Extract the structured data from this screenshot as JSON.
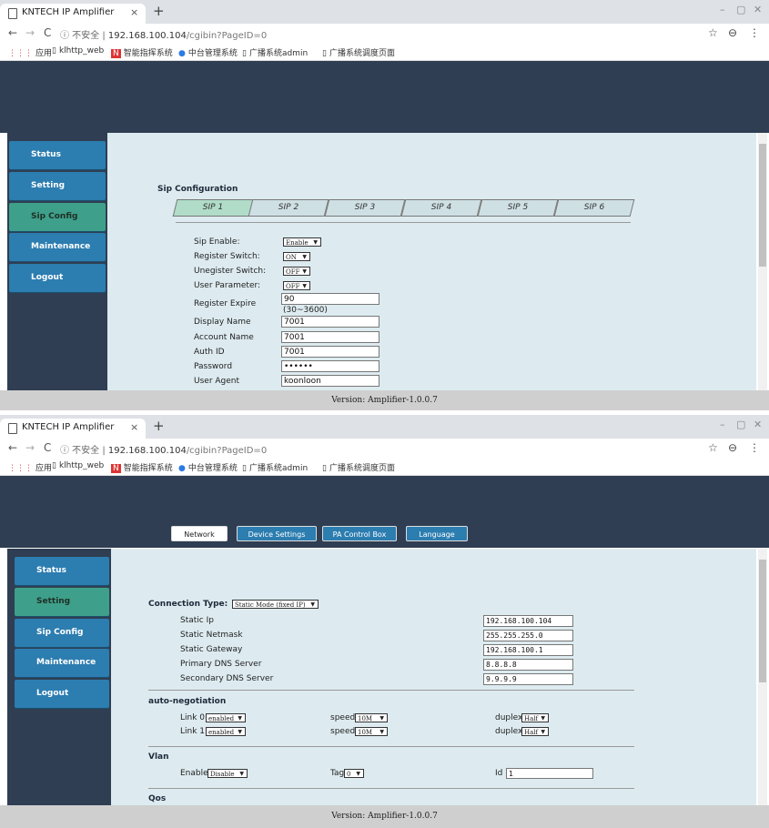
{
  "browser": {
    "tab_title": "KNTECH IP Amplifier",
    "tab_close": "×",
    "new_tab": "+",
    "back": "←",
    "forward": "→",
    "reload": "C",
    "url_info": "ⓘ 不安全 |",
    "url_host": "192.168.100.104",
    "url_path": "/cgibin?PageID=0",
    "star": "☆",
    "account": "⊖",
    "menu": "⋮",
    "win_min": "–",
    "win_max": "▢",
    "win_close": "✕",
    "bookmarks": [
      "应用",
      "klhttp_web",
      "智能指挥系统",
      "中台管理系统",
      "广播系统admin",
      "广播系统调度页面"
    ]
  },
  "nav": {
    "status": "Status",
    "setting": "Setting",
    "sip_config": "Sip Config",
    "maintenance": "Maintenance",
    "logout": "Logout"
  },
  "footer": {
    "version": "Version: Amplifier-1.0.0.7"
  },
  "sip_page": {
    "section_title": "Sip Configuration",
    "tabs": [
      "SIP 1",
      "SIP 2",
      "SIP 3",
      "SIP 4",
      "SIP 5",
      "SIP 6"
    ],
    "active_tab": "SIP 1",
    "sip_enable_label": "Sip Enable:",
    "sip_enable_value": "Enable",
    "register_switch_label": "Register Switch:",
    "register_switch_value": "ON",
    "unregister_switch_label": "Unegister Switch:",
    "unregister_switch_value": "OFF",
    "user_parameter_label": "User Parameter:",
    "user_parameter_value": "OFF",
    "register_expire_label": "Register Expire",
    "register_expire_value": "90",
    "register_expire_hint": "(30~3600)",
    "display_name_label": "Display Name",
    "display_name_value": "7001",
    "account_name_label": "Account Name",
    "account_name_value": "7001",
    "auth_id_label": "Auth ID",
    "auth_id_value": "7001",
    "password_label": "Password",
    "password_value": "••••••",
    "user_agent_label": "User Agent",
    "user_agent_value": "koonloon"
  },
  "network_page": {
    "top_tabs": [
      "Network",
      "Device Settings",
      "PA Control Box",
      "Language"
    ],
    "active_top_tab": "Network",
    "connection_type_label": "Connection Type:",
    "connection_type_value": "Static Mode (fixed IP)",
    "static_ip_label": "Static Ip",
    "static_ip_value": "192.168.100.104",
    "static_netmask_label": "Static Netmask",
    "static_netmask_value": "255.255.255.0",
    "static_gateway_label": "Static Gateway",
    "static_gateway_value": "192.168.100.1",
    "primary_dns_label": "Primary DNS Server",
    "primary_dns_value": "8.8.8.8",
    "secondary_dns_label": "Secondary DNS Server",
    "secondary_dns_value": "9.9.9.9",
    "autoneg_title": "auto-negotiation",
    "link0_label": "Link 0",
    "link0_value": "enabled",
    "link1_label": "Link 1",
    "link1_value": "enabled",
    "speed_label": "speed",
    "speed0_value": "10M",
    "speed1_value": "10M",
    "duplex_label": "duplex",
    "duplex0_value": "Half",
    "duplex1_value": "Half",
    "vlan_title": "Vlan",
    "vlan_enable_label": "Enable",
    "vlan_enable_value": "Disable",
    "vlan_tag_label": "Tag",
    "vlan_tag_value": "0",
    "vlan_id_label": "Id",
    "vlan_id_value": "1",
    "qos_title": "Qos"
  }
}
